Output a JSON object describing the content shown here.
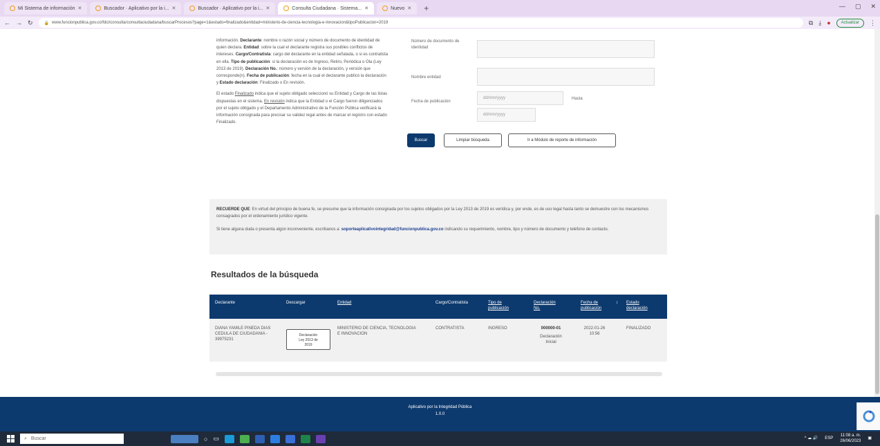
{
  "browser": {
    "tabs": [
      {
        "label": "Mi Sistema de información",
        "active": false
      },
      {
        "label": "Buscador · Aplicativo por la i...",
        "active": false
      },
      {
        "label": "Buscador · Aplicativo por la i...",
        "active": false
      },
      {
        "label": "Consulta Ciudadana · Sistema...",
        "active": true
      },
      {
        "label": "Nuevo",
        "active": false
      }
    ],
    "new_tab": "+",
    "url": "www.funcionpublica.gov.co/fdci/consulta/consultaciudadana/buscarProcesos?page=1&estado=finalizado&entidad=ministerio-de-ciencia-tecnologia-e-innovacion&tipoPublicacion=2019",
    "update_button": "Actualizar"
  },
  "sidebar_help": {
    "p1_parts": [
      {
        "text": "información. ",
        "bold": false
      },
      {
        "text": "Declarante",
        "bold": true
      },
      {
        "text": ": nombre o razón social y número de documento de identidad de quien declara. ",
        "bold": false
      },
      {
        "text": "Entidad",
        "bold": true
      },
      {
        "text": ": sobre la cual el declarante registra sus posibles conflictos de intereses. ",
        "bold": false
      },
      {
        "text": "Cargo/Contratista",
        "bold": true
      },
      {
        "text": ": cargo del declarante en la entidad señalada, o si es contratista en ella. ",
        "bold": false
      },
      {
        "text": "Tipo de publicación",
        "bold": true
      },
      {
        "text": ": si la declaración es de Ingreso, Retiro, Periódica o Ola (Ley 2013 de 2019). ",
        "bold": false
      },
      {
        "text": "Declaración No.",
        "bold": true
      },
      {
        "text": ": número y versión de la declaración, y versión que corresponde(n). ",
        "bold": false
      },
      {
        "text": "Fecha de publicación",
        "bold": true
      },
      {
        "text": ": fecha en la cual el declarante publicó la declaración y ",
        "bold": false
      },
      {
        "text": "Estado declaración",
        "bold": true
      },
      {
        "text": ": Finalizado o En revisión.",
        "bold": false
      }
    ],
    "p2_intro": "El estado ",
    "p2_link1": "Finalizado",
    "p2_mid": " indica que el sujeto obligado seleccionó su Entidad y Cargo de las listas dispuestas en el sistema. ",
    "p2_link2": "En revisión",
    "p2_rest": " indica que la Entidad o el Cargo fueron diligenciados por el sujeto obligado y el Departamento Administrativo de la Función Pública verificará la información consignada para precisar su validez legal antes de marcar el registro con estado Finalizado."
  },
  "form": {
    "doc_label": "Número de documento de identidad",
    "entity_label": "Nombre entidad",
    "date_label": "Fecha de publicación",
    "date_from_placeholder": "dd/mm/yyyy",
    "date_to_placeholder": "dd/mm/yyyy",
    "hasta_label": "Hasta",
    "search_button": "Buscar",
    "clear_button": "Limpiar búsqueda",
    "back_button": "Ir a Módulo de reporte de información"
  },
  "notice": {
    "title": "RECUERDE QUE",
    "text1": ": En virtud del principio de buena fe, se presume que la información consignada por los sujetos obligados por la Ley 2013 de 2019 es verídica y, por ende, es de uso legal hasta tanto se demuestre con los mecanismos consagrados por el ordenamiento jurídico vigente.",
    "text2a": "Si tiene alguna duda o presenta algún inconveniente, escríbanos a: ",
    "email": "soporteaplicativointegridad@funcionpublica.gov.co",
    "text2b": " indicando su requerimiento, nombre, tipo y número de documento y teléfono de contacto."
  },
  "results": {
    "title": "Resultados de la búsqueda",
    "headers": {
      "declarante": "Declarante",
      "descargar": "Descargar",
      "entidad": "Entidad",
      "cargo": "Cargo/Contratista",
      "tipo1": "Tipo de",
      "tipo2": "publicación",
      "decl1": "Declaración",
      "decl2": "No.",
      "fecha1": "Fecha de",
      "fecha2": "publicación",
      "estado1": "Estado",
      "estado2": "declaración"
    },
    "row": {
      "declarante": "DIANA YAMILE PINEDA DIAS",
      "declarante2": "CEDULA DE CIUDADANIA -",
      "declarante3": "39975231",
      "download1": "Declaración",
      "download2": "Ley 2013 de",
      "download3": "2019",
      "entidad1": "MINISTERIO DE CIENCIA, TECNOLOGIA",
      "entidad2": "E INNOVACION",
      "cargo": "CONTRATISTA",
      "tipo": "INGRESO",
      "decl_no": "000000-01",
      "decl_sub1": "Declaración",
      "decl_sub2": "Inicial",
      "fecha1": "2022-01-26",
      "fecha2": "10:56",
      "estado": "FINALIZADO"
    }
  },
  "footer": {
    "line1": "Aplicativo por la Integridad Pública",
    "line2": "1.0.0"
  },
  "taskbar": {
    "search_placeholder": "Buscar",
    "time": "11:08 a. m.",
    "date": "26/06/2023",
    "lang": "ESP"
  }
}
